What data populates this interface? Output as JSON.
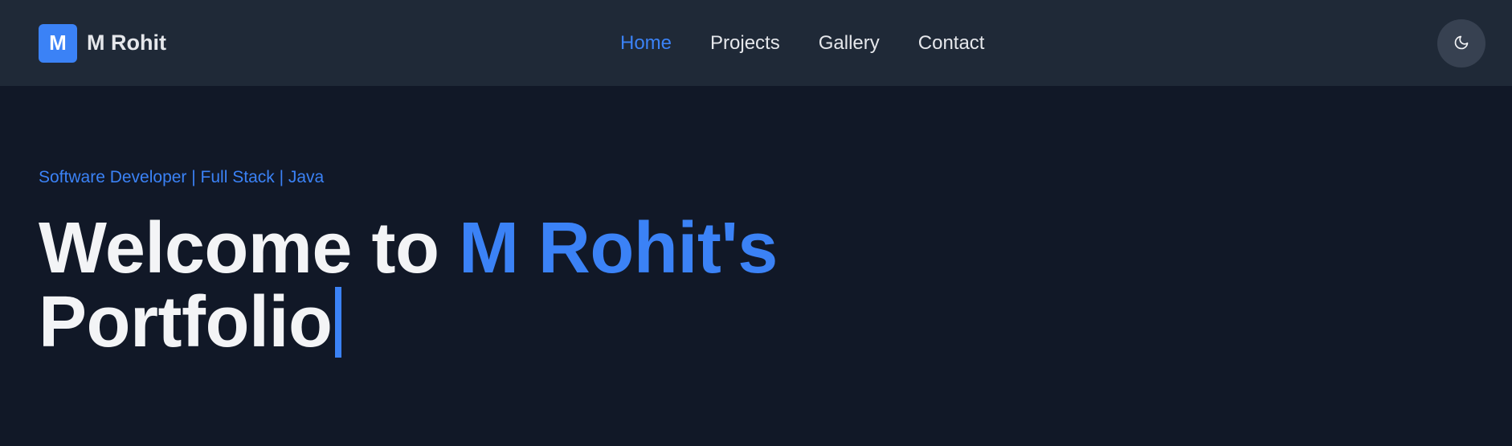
{
  "header": {
    "logo_letter": "M",
    "brand_name": "M Rohit",
    "nav": [
      {
        "label": "Home",
        "active": true
      },
      {
        "label": "Projects",
        "active": false
      },
      {
        "label": "Gallery",
        "active": false
      },
      {
        "label": "Contact",
        "active": false
      }
    ],
    "theme_toggle_icon": "moon-icon"
  },
  "hero": {
    "tagline": "Software Developer | Full Stack | Java",
    "headline_prefix": "Welcome to ",
    "headline_accent": "M Rohit's",
    "headline_suffix": "Portfolio"
  },
  "colors": {
    "accent": "#3b82f6",
    "nav_background": "#1f2937",
    "page_background": "#111827",
    "toggle_background": "#374151",
    "text_primary": "#f3f4f6"
  }
}
